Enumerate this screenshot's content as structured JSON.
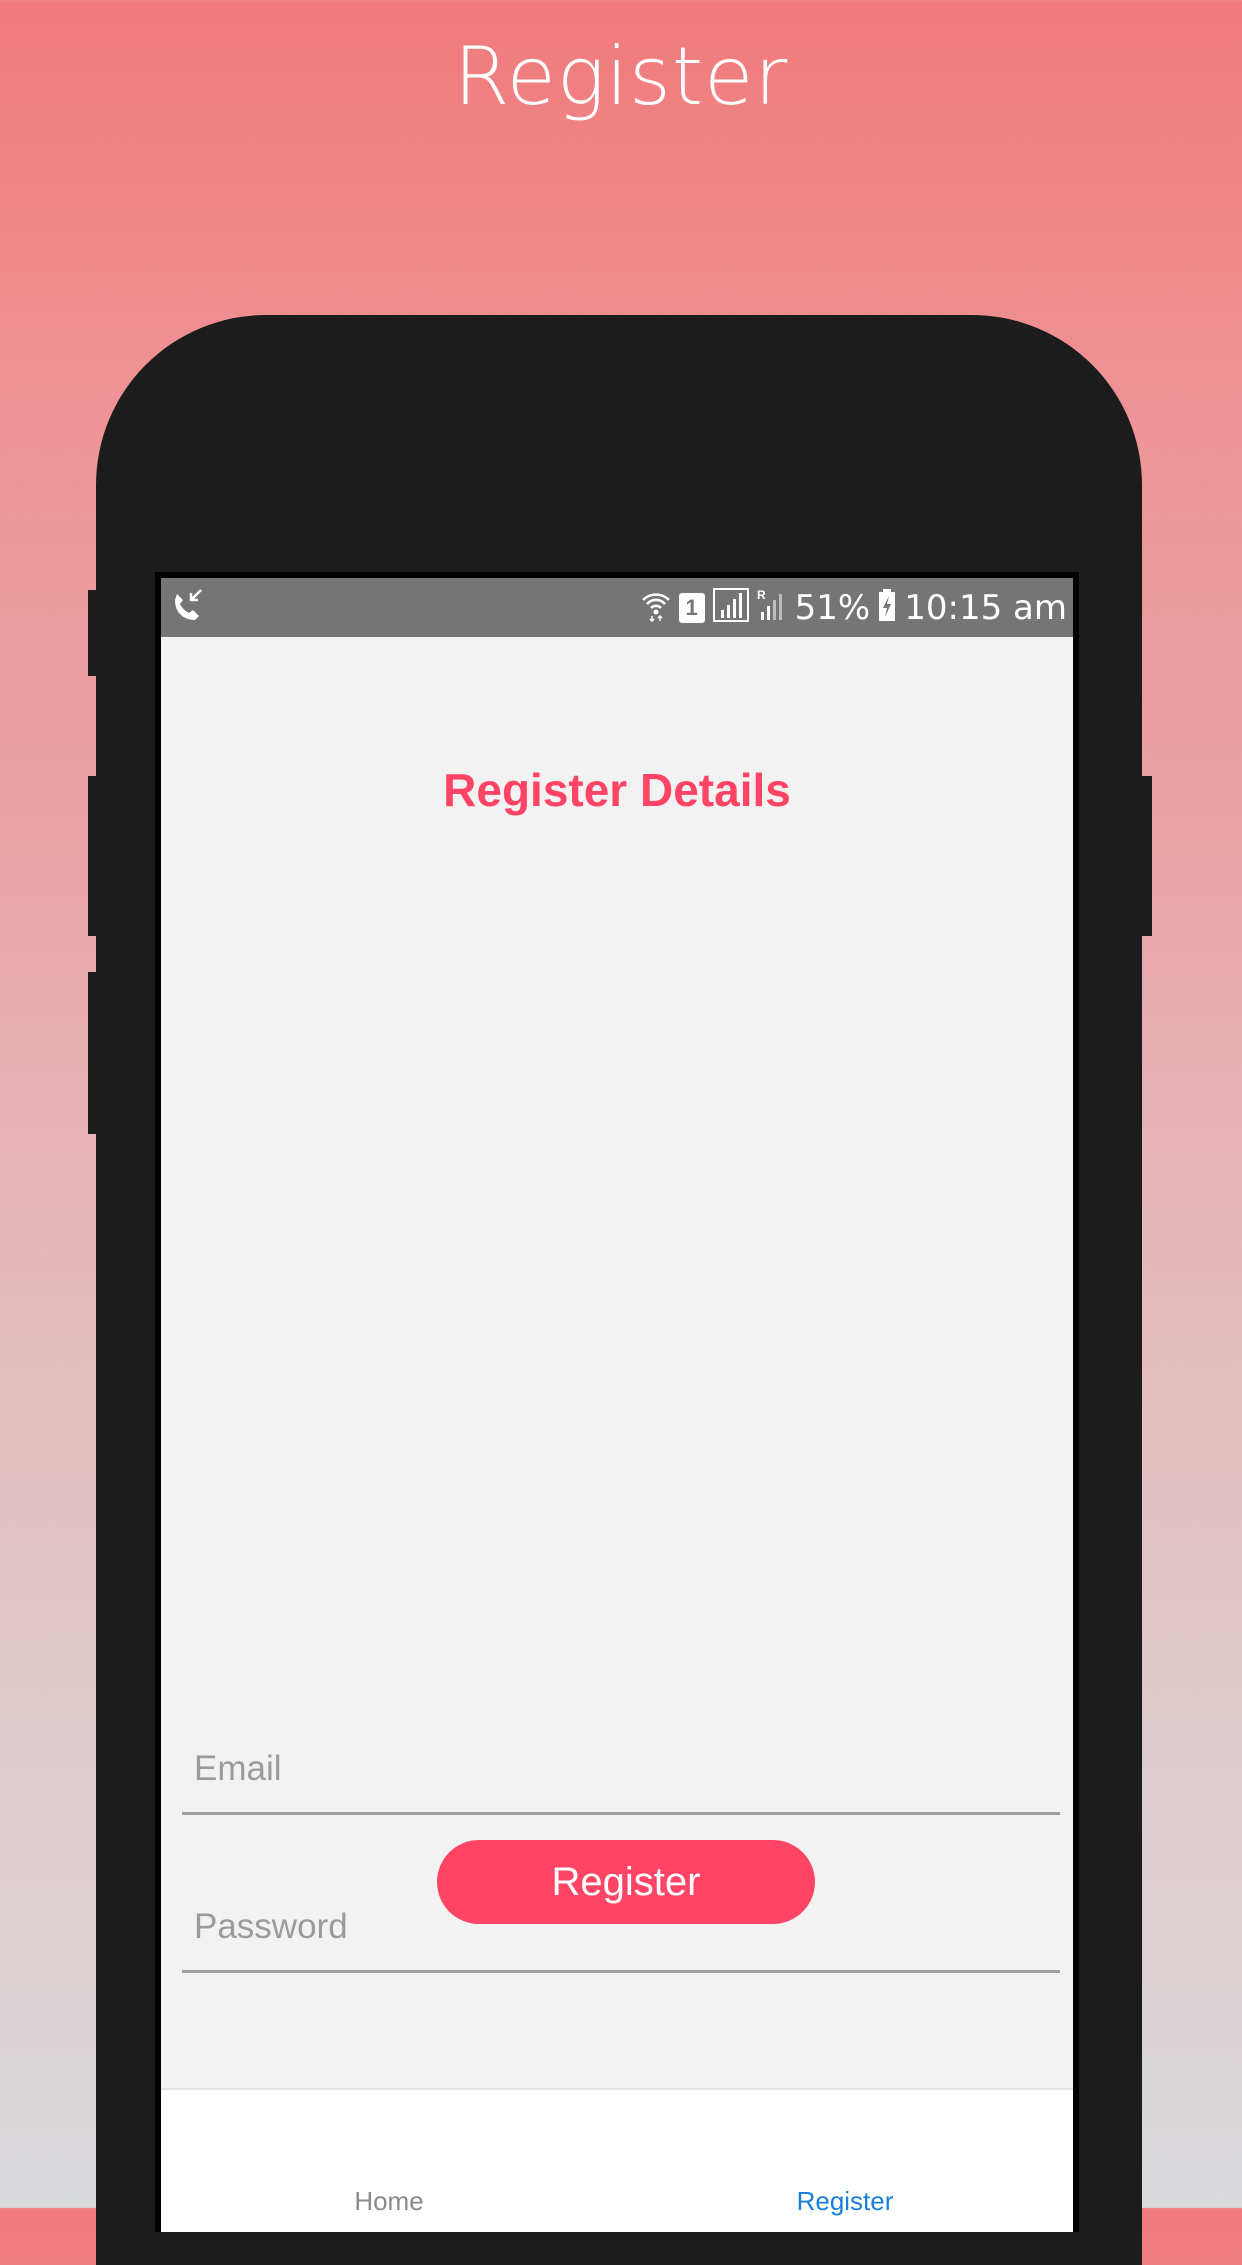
{
  "banner": {
    "title": "Register"
  },
  "status_bar": {
    "left_icon": "call-received-icon",
    "sim_slot": "1",
    "battery_percent": "51%",
    "time": "10:15 am",
    "icons": [
      "wifi-icon",
      "sim-icon",
      "signal-icon",
      "roaming-signal-icon",
      "battery-charging-icon"
    ]
  },
  "form": {
    "title": "Register Details",
    "email_placeholder": "Email",
    "password_placeholder": "Password",
    "email_value": "",
    "password_value": "",
    "submit_label": "Register"
  },
  "tab_bar": {
    "tabs": [
      {
        "label": "Home",
        "active": false
      },
      {
        "label": "Register",
        "active": true
      }
    ]
  },
  "colors": {
    "accent": "#ff4466",
    "active_tab": "#1a7fd9",
    "inactive_tab": "#8a8a8a",
    "status_bar": "#757575",
    "screen_bg": "#f2f2f2",
    "phone_body": "#1c1c1c"
  }
}
